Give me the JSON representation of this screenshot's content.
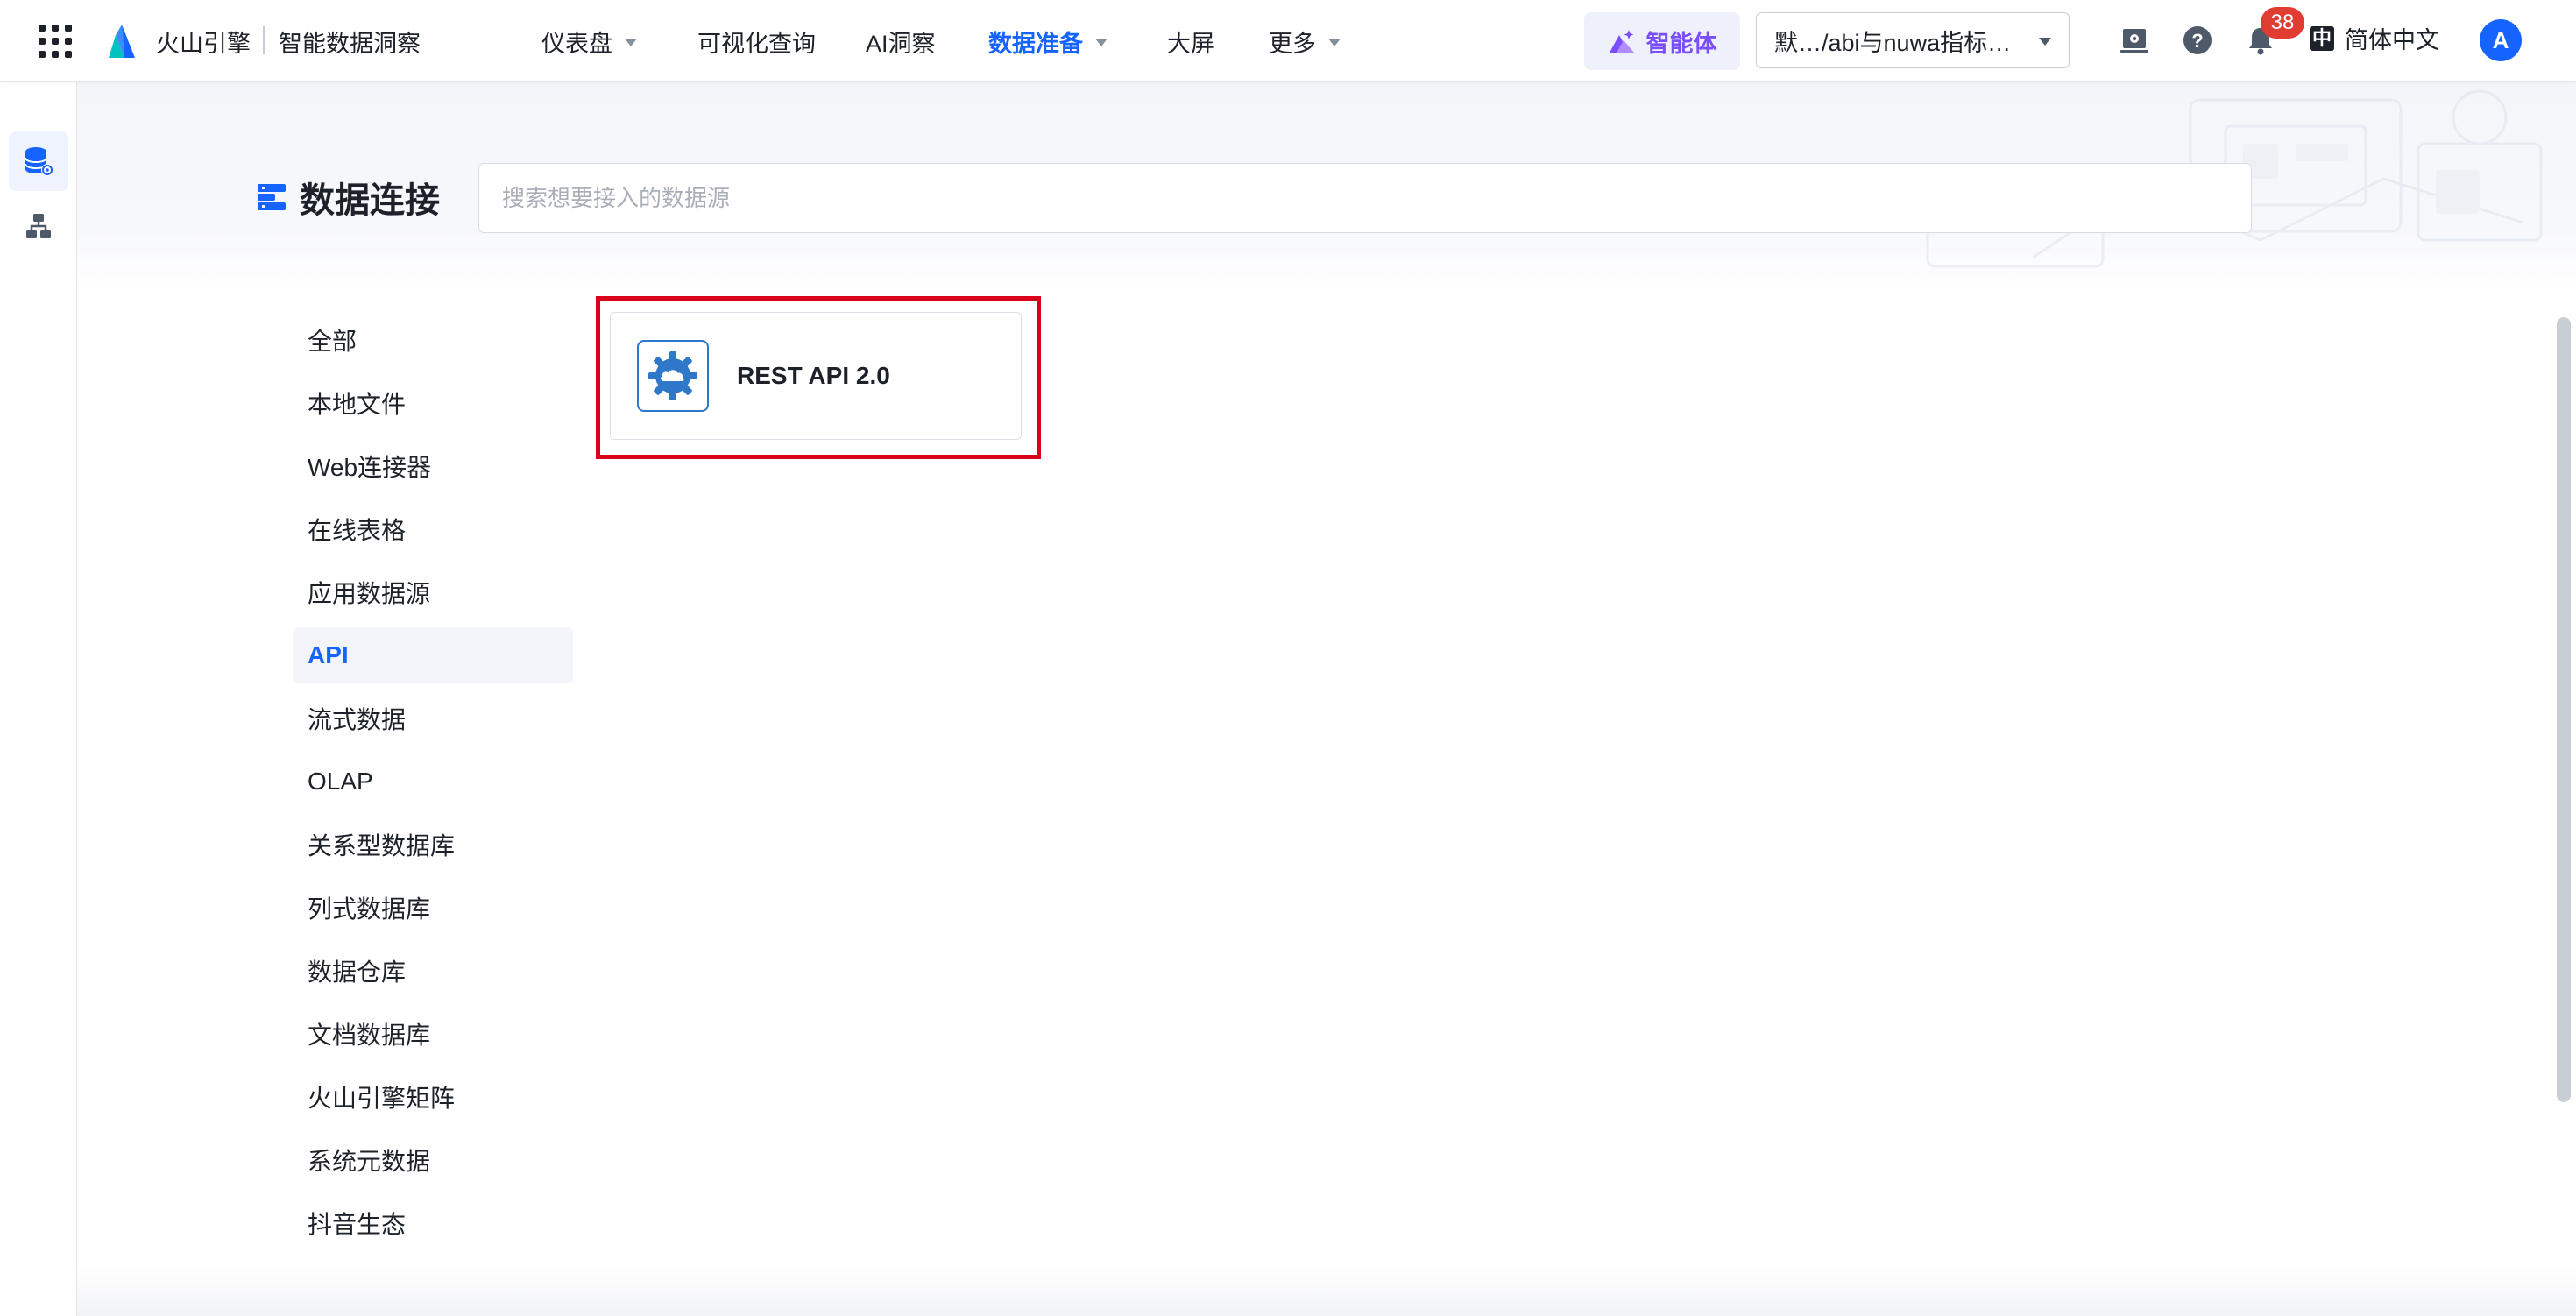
{
  "header": {
    "brand": "火山引擎",
    "product": "智能数据洞察",
    "nav": [
      {
        "label": "仪表盘",
        "has_caret": true
      },
      {
        "label": "可视化查询",
        "has_caret": false
      },
      {
        "label": "AI洞察",
        "has_caret": false
      },
      {
        "label": "数据准备",
        "has_caret": true,
        "active": true
      },
      {
        "label": "大屏",
        "has_caret": false
      },
      {
        "label": "更多",
        "has_caret": true
      }
    ],
    "agent_label": "智能体",
    "workspace": "默…/abi与nuwa指标…",
    "notification_count": "38",
    "language": "简体中文",
    "language_icon": "中",
    "avatar": "A"
  },
  "page": {
    "title": "数据连接",
    "search_placeholder": "搜索想要接入的数据源"
  },
  "categories": [
    "全部",
    "本地文件",
    "Web连接器",
    "在线表格",
    "应用数据源",
    "API",
    "流式数据",
    "OLAP",
    "关系型数据库",
    "列式数据库",
    "数据仓库",
    "文档数据库",
    "火山引擎矩阵",
    "系统元数据",
    "抖音生态"
  ],
  "active_category": "API",
  "connectors": [
    {
      "label": "REST API 2.0",
      "icon": "cloud-gear-icon"
    }
  ],
  "colors": {
    "accent": "#1664ff",
    "agent": "#7a4dff",
    "badge": "#e03c31",
    "highlight": "#d9001b"
  }
}
